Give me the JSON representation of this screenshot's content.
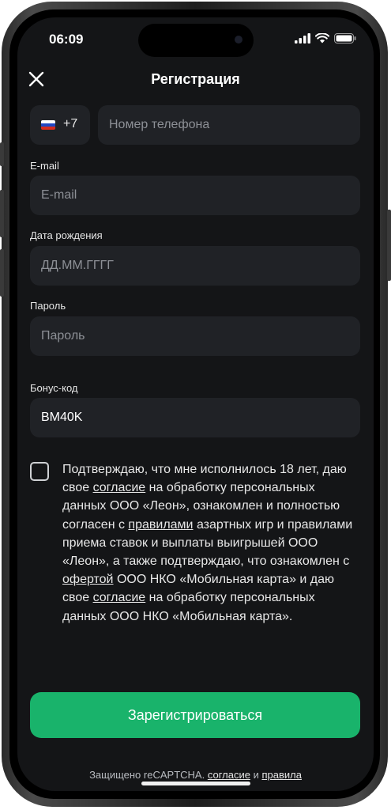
{
  "status_bar": {
    "time": "06:09"
  },
  "header": {
    "title": "Регистрация"
  },
  "phone": {
    "country_code": "+7",
    "placeholder": "Номер телефона"
  },
  "email": {
    "label": "E-mail",
    "placeholder": "E-mail"
  },
  "birthdate": {
    "label": "Дата рождения",
    "placeholder": "ДД.ММ.ГГГГ"
  },
  "password": {
    "label": "Пароль",
    "placeholder": "Пароль"
  },
  "bonus": {
    "label": "Бонус-код",
    "value": "BM40K"
  },
  "consent": {
    "part1": "Подтверждаю, что мне исполнилось 18 лет, даю свое ",
    "link1": "согласие",
    "part2": " на обработку персональных данных ООО «Леон», ознакомлен и полностью согласен с ",
    "link2": "правилами",
    "part3": " азартных игр и правилами приема ставок и выплаты выигрышей ООО «Леон», а также подтверждаю, что ознакомлен с ",
    "link3": "офертой",
    "part4": " ООО НКО «Мобильная карта» и даю свое ",
    "link4": "согласие",
    "part5": " на обработку персональных данных ООО НКО «Мобильная карта»."
  },
  "submit": {
    "label": "Зарегистрироваться"
  },
  "footer": {
    "prefix": "Защищено reCAPTCHA. ",
    "link1": "согласие",
    "middle": " и ",
    "link2": "правила"
  },
  "colors": {
    "background": "#141517",
    "field": "#202226",
    "accent": "#19b36b"
  },
  "icons": [
    "close-icon",
    "russia-flag-icon",
    "signal-icon",
    "wifi-icon",
    "battery-icon"
  ]
}
